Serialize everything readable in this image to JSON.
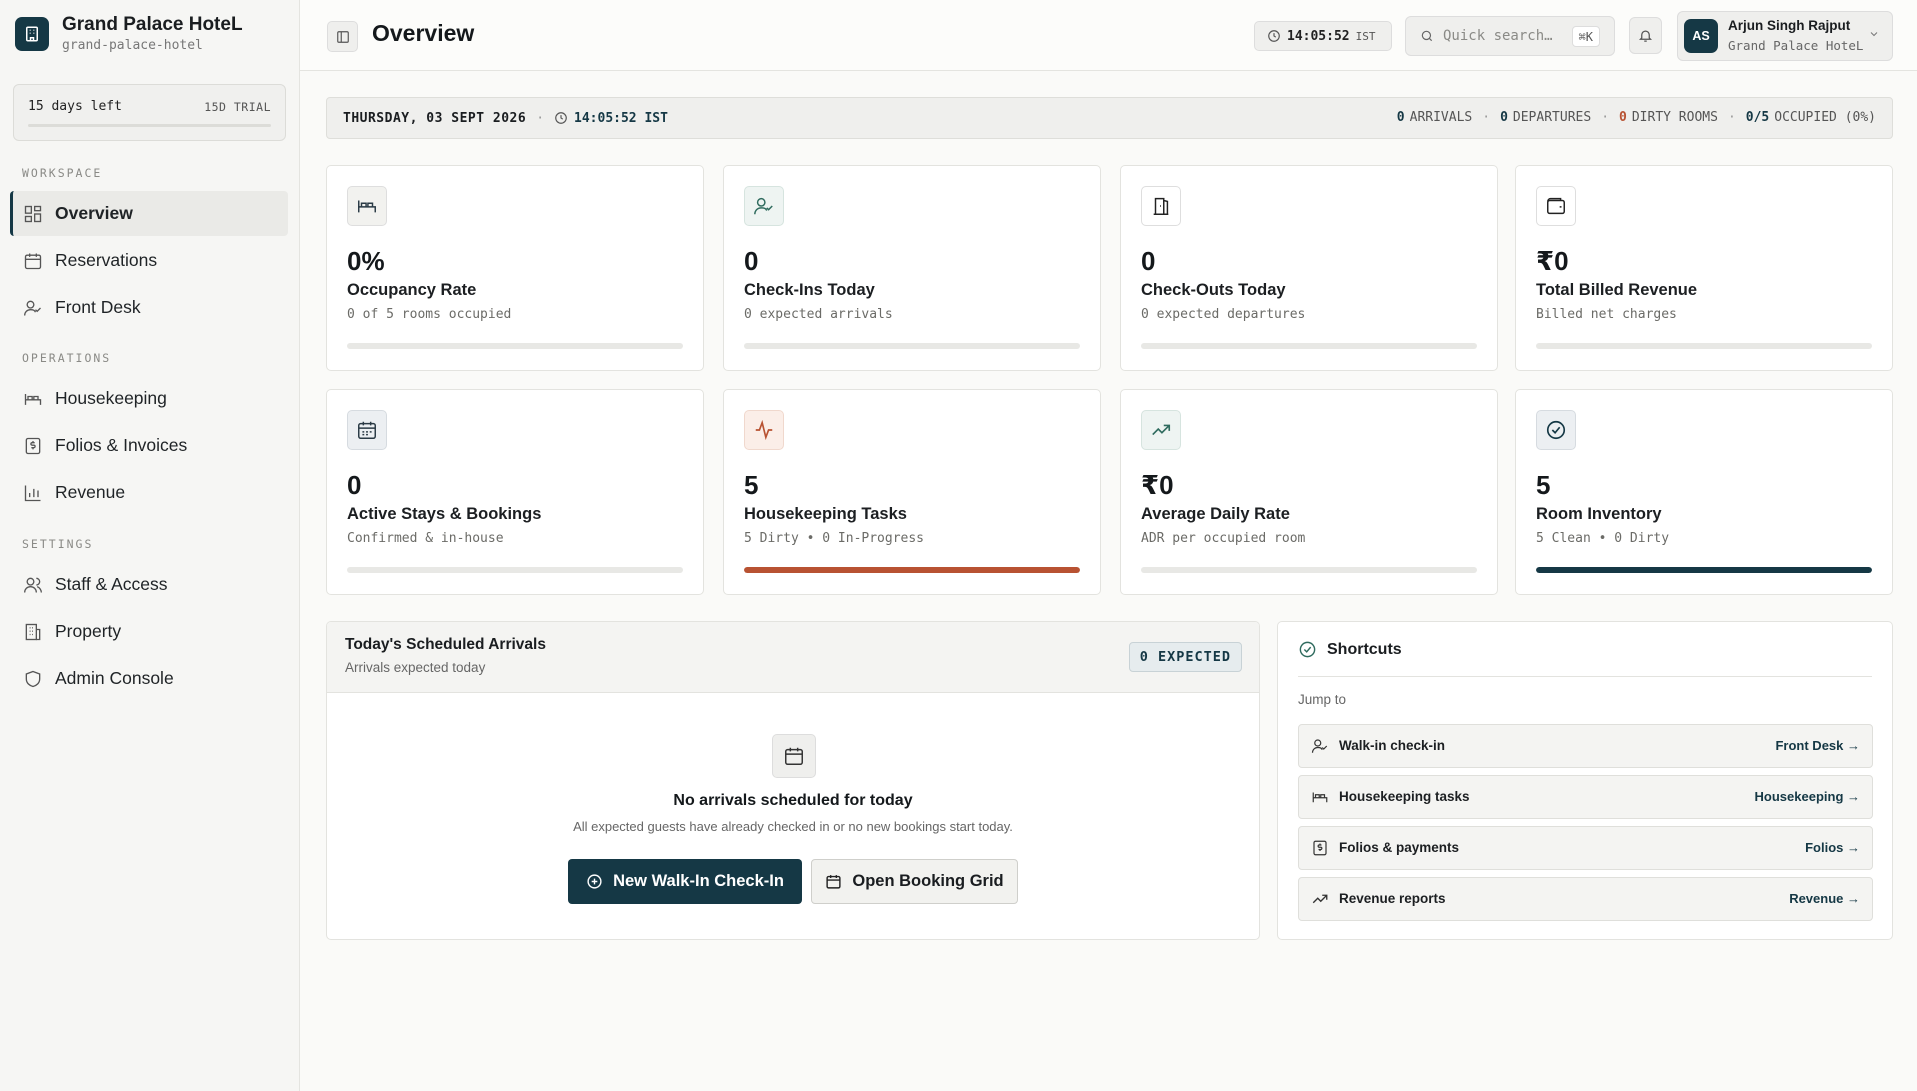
{
  "brand": {
    "name": "Grand Palace HoteL",
    "slug": "grand-palace-hotel"
  },
  "trial": {
    "left": "15 days left",
    "badge": "15D TRIAL"
  },
  "nav": {
    "sections": [
      "WORKSPACE",
      "OPERATIONS",
      "SETTINGS"
    ],
    "items": [
      {
        "label": "Overview",
        "icon": "grid-icon",
        "active": true
      },
      {
        "label": "Reservations",
        "icon": "calendar-icon"
      },
      {
        "label": "Front Desk",
        "icon": "user-check-icon"
      },
      {
        "label": "Housekeeping",
        "icon": "bed-icon"
      },
      {
        "label": "Folios & Invoices",
        "icon": "invoice-icon"
      },
      {
        "label": "Revenue",
        "icon": "bar-chart-icon"
      },
      {
        "label": "Staff & Access",
        "icon": "users-icon"
      },
      {
        "label": "Property",
        "icon": "building-icon"
      },
      {
        "label": "Admin Console",
        "icon": "shield-icon"
      }
    ]
  },
  "header": {
    "title": "Overview",
    "clock": "14:05:52",
    "tz": "IST",
    "search_placeholder": "Quick search…",
    "search_shortcut": "⌘K",
    "user": {
      "initials": "AS",
      "name": "Arjun Singh Rajput",
      "hotel": "Grand Palace HoteL"
    }
  },
  "strip": {
    "date": "THURSDAY, 03 SEPT 2026",
    "time": "14:05:52 IST",
    "arrivals_count": "0",
    "arrivals_label": "ARRIVALS",
    "departures_count": "0",
    "departures_label": "DEPARTURES",
    "dirty_count": "0",
    "dirty_label": "DIRTY ROOMS",
    "occupied_count": "0/5",
    "occupied_label": "OCCUPIED (0%)"
  },
  "cards": [
    {
      "value": "0%",
      "label": "Occupancy Rate",
      "sub": "0 of 5 rooms occupied",
      "icon": "bed-icon",
      "progress": 0,
      "color": "#e8e8e5"
    },
    {
      "value": "0",
      "label": "Check-Ins Today",
      "sub": "0 expected arrivals",
      "icon": "user-check-icon",
      "progress": 0,
      "color": "#e8e8e5"
    },
    {
      "value": "0",
      "label": "Check-Outs Today",
      "sub": "0 expected departures",
      "icon": "door-open-icon",
      "progress": 0,
      "color": "#e8e8e5"
    },
    {
      "value": "₹0",
      "label": "Total Billed Revenue",
      "sub": "Billed net charges",
      "icon": "wallet-icon",
      "progress": 0,
      "color": "#e8e8e5"
    },
    {
      "value": "0",
      "label": "Active Stays & Bookings",
      "sub": "Confirmed & in-house",
      "icon": "calendar-icon",
      "progress": 0,
      "color": "#e8e8e5"
    },
    {
      "value": "5",
      "label": "Housekeeping Tasks",
      "sub": "5 Dirty • 0 In-Progress",
      "icon": "activity-icon",
      "progress": 1,
      "color": "#b85232"
    },
    {
      "value": "₹0",
      "label": "Average Daily Rate",
      "sub": "ADR per occupied room",
      "icon": "trending-up-icon",
      "progress": 0,
      "color": "#e8e8e5"
    },
    {
      "value": "5",
      "label": "Room Inventory",
      "sub": "5 Clean • 0 Dirty",
      "icon": "check-circle-icon",
      "progress": 1,
      "color": "#153845"
    }
  ],
  "arrivals": {
    "title": "Today's Scheduled Arrivals",
    "subtitle": "Arrivals expected today",
    "badge": "0 EXPECTED",
    "empty_title": "No arrivals scheduled for today",
    "empty_sub": "All expected guests have already checked in or no new bookings start today.",
    "primary_button": "New Walk-In Check-In",
    "secondary_button": "Open Booking Grid"
  },
  "shortcuts": {
    "title": "Shortcuts",
    "jump_label": "Jump to",
    "items": [
      {
        "label": "Walk-in check-in",
        "link": "Front Desk →",
        "icon": "user-check-icon"
      },
      {
        "label": "Housekeeping tasks",
        "link": "Housekeeping →",
        "icon": "bed-icon"
      },
      {
        "label": "Folios & payments",
        "link": "Folios →",
        "icon": "invoice-icon"
      },
      {
        "label": "Revenue reports",
        "link": "Revenue →",
        "icon": "trending-up-icon"
      }
    ]
  },
  "colors": {
    "accent": "#153845",
    "warn": "#b85232"
  }
}
